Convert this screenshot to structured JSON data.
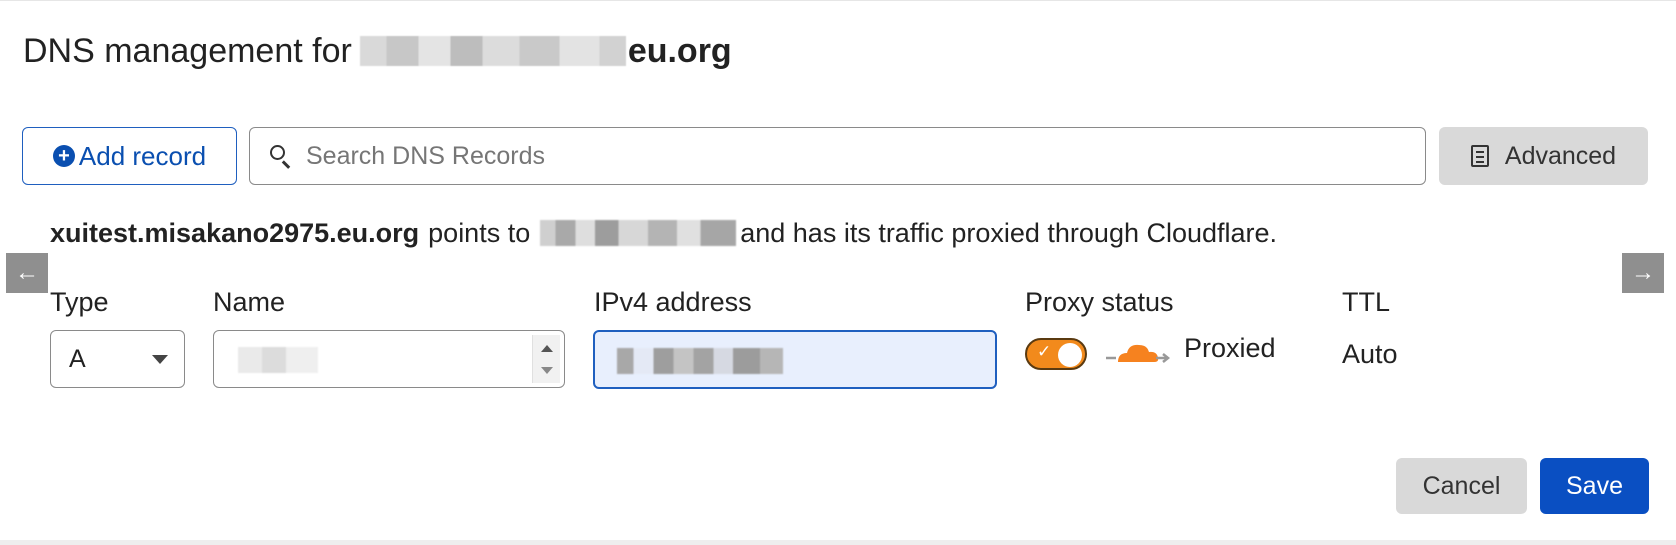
{
  "header": {
    "title_prefix": "DNS management for",
    "domain_suffix": "eu.org"
  },
  "toolbar": {
    "add_record_label": "Add record",
    "search_placeholder": "Search DNS Records",
    "advanced_label": "Advanced"
  },
  "record_info": {
    "hostname": "xuitest.misakano2975.eu.org",
    "points_to": "points to",
    "trailing": "and has its traffic proxied through Cloudflare."
  },
  "form": {
    "labels": {
      "type": "Type",
      "name": "Name",
      "ipv4": "IPv4 address",
      "proxy_status": "Proxy status",
      "ttl": "TTL"
    },
    "type_value": "A",
    "proxy_enabled": true,
    "proxy_label": "Proxied",
    "ttl_value": "Auto"
  },
  "actions": {
    "cancel_label": "Cancel",
    "save_label": "Save"
  },
  "colors": {
    "primary_blue": "#0a4fc2",
    "proxy_orange": "#f28a1c",
    "cloud_orange": "#f6821f",
    "input_focus_bg": "#e8effd"
  },
  "icons": {
    "add": "plus-circle-icon",
    "search": "search-icon",
    "advanced": "document-icon",
    "prev": "arrow-left-icon",
    "next": "arrow-right-icon",
    "proxy": "cloud-icon"
  }
}
